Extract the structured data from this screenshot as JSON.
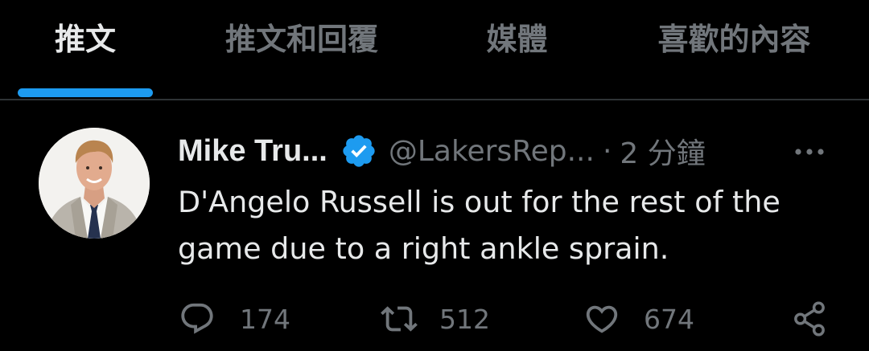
{
  "colors": {
    "background": "#000000",
    "primary_text": "#e7e9ea",
    "secondary_text": "#71767b",
    "accent": "#1d9bf0",
    "divider": "#2f3336"
  },
  "tabs": [
    {
      "label": "推文",
      "active": true
    },
    {
      "label": "推文和回覆",
      "active": false
    },
    {
      "label": "媒體",
      "active": false
    },
    {
      "label": "喜歡的內容",
      "active": false
    }
  ],
  "tweet": {
    "display_name": "Mike Tru...",
    "verified_icon": "verified-badge-icon",
    "handle": "@LakersRep...",
    "separator": "·",
    "time": "2 分鐘",
    "more_icon": "more-icon",
    "text": "D'Angelo Russell is out for the rest of the game due to a right ankle sprain.",
    "actions": {
      "reply": {
        "icon": "reply-icon",
        "count": "174"
      },
      "retweet": {
        "icon": "retweet-icon",
        "count": "512"
      },
      "like": {
        "icon": "like-icon",
        "count": "674"
      },
      "share": {
        "icon": "share-icon"
      }
    }
  }
}
